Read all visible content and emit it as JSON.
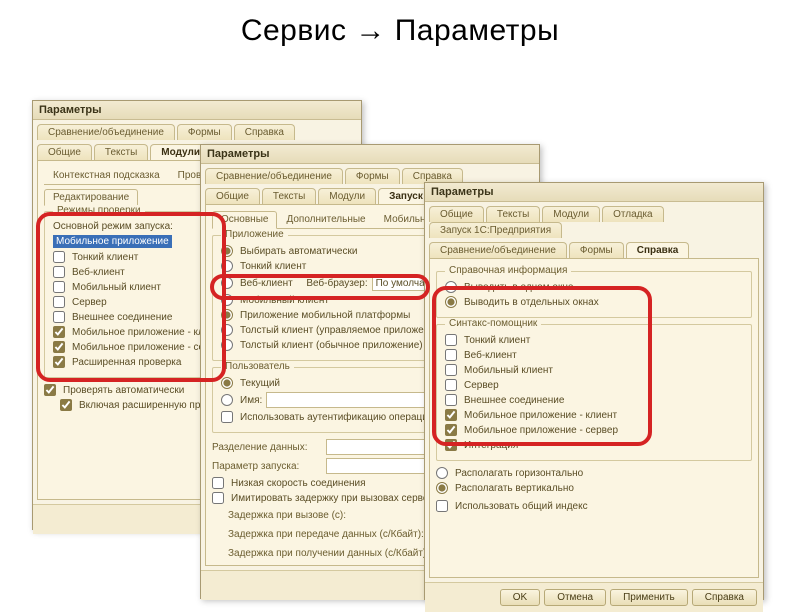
{
  "slide": {
    "title": "Сервис → Параметры"
  },
  "common": {
    "window_title": "Параметры",
    "tabs_row1": [
      "Сравнение/объединение",
      "Формы",
      "Справка"
    ],
    "tabs_row2": [
      "Общие",
      "Тексты",
      "Модули",
      "Отладка",
      "Запуск 1С:Предприятия"
    ],
    "buttons": {
      "ok": "OK",
      "cancel": "Отмена",
      "apply": "Применить",
      "help": "Справка"
    }
  },
  "win1": {
    "subtabs": [
      "Контекстная подсказка",
      "Проверка"
    ],
    "active_subtab": "Редактирование",
    "group_modes": {
      "legend": "Режимы проверки",
      "launch_mode_label": "Основной режим запуска:",
      "launch_mode_value": "Мобильное приложение",
      "items": [
        {
          "label": "Тонкий клиент",
          "checked": false
        },
        {
          "label": "Веб-клиент",
          "checked": false
        },
        {
          "label": "Мобильный клиент",
          "checked": false
        },
        {
          "label": "Сервер",
          "checked": false
        },
        {
          "label": "Внешнее соединение",
          "checked": false
        },
        {
          "label": "Мобильное приложение - клиент",
          "checked": true
        },
        {
          "label": "Мобильное приложение - сервер",
          "checked": true
        },
        {
          "label": "Расширенная проверка",
          "checked": true
        }
      ]
    },
    "auto_check": {
      "label": "Проверять автоматически",
      "checked": true
    },
    "ext_check": {
      "label": "Включая расширенную проверку",
      "checked": true
    }
  },
  "win2": {
    "subtabs": [
      "Основные",
      "Дополнительные",
      "Мобильные приложения"
    ],
    "group_app": {
      "legend": "Приложение",
      "auto_select": {
        "label": "Выбирать автоматически",
        "checked": true
      },
      "thin": {
        "label": "Тонкий клиент",
        "checked": false
      },
      "web_client": {
        "label": "Веб-клиент",
        "checked": false
      },
      "web_browser_label": "Веб-браузер:",
      "web_browser_value": "По умолчанию",
      "mobile_client": {
        "label": "Мобильный клиент",
        "checked": false
      },
      "mobile_platform": {
        "label": "Приложение мобильной платформы",
        "checked": true
      },
      "thick_managed": {
        "label": "Толстый клиент (управляемое приложение)",
        "checked": false
      },
      "thick_ordinary": {
        "label": "Толстый клиент (обычное приложение)",
        "checked": false
      }
    },
    "group_user": {
      "legend": "Пользователь",
      "current": {
        "label": "Текущий",
        "checked": true
      },
      "name": {
        "label": "Имя:",
        "checked": false,
        "value": ""
      },
      "use_auth": {
        "label": "Использовать аутентификацию операционной системы",
        "checked": false
      }
    },
    "split_label": "Разделение данных:",
    "launch_param_label": "Параметр запуска:",
    "low_speed": {
      "label": "Низкая скорость соединения",
      "checked": false
    },
    "simulate_delay": {
      "label": "Имитировать задержку при вызовах сервера",
      "checked": false
    },
    "delay_call": "Задержка при вызове (с):",
    "delay_send": "Задержка при передаче данных (с/Кбайт):",
    "delay_recv": "Задержка при получении данных (с/Кбайт):"
  },
  "win3": {
    "group_info": {
      "legend": "Справочная информация",
      "one_window": {
        "label": "Выводить в одном окне",
        "checked": false
      },
      "each_window": {
        "label": "Выводить в отдельных окнах",
        "checked": true
      }
    },
    "group_syntax": {
      "legend": "Синтакс-помощник",
      "items": [
        {
          "label": "Тонкий клиент",
          "checked": false
        },
        {
          "label": "Веб-клиент",
          "checked": false
        },
        {
          "label": "Мобильный клиент",
          "checked": false
        },
        {
          "label": "Сервер",
          "checked": false
        },
        {
          "label": "Внешнее соединение",
          "checked": false
        },
        {
          "label": "Мобильное приложение - клиент",
          "checked": true
        },
        {
          "label": "Мобильное приложение - сервер",
          "checked": true
        },
        {
          "label": "Интеграция",
          "checked": true
        }
      ]
    },
    "arrange_h": {
      "label": "Располагать горизонтально",
      "checked": false
    },
    "arrange_v": {
      "label": "Располагать вертикально",
      "checked": true
    },
    "use_index": {
      "label": "Использовать общий индекс",
      "checked": false
    }
  }
}
